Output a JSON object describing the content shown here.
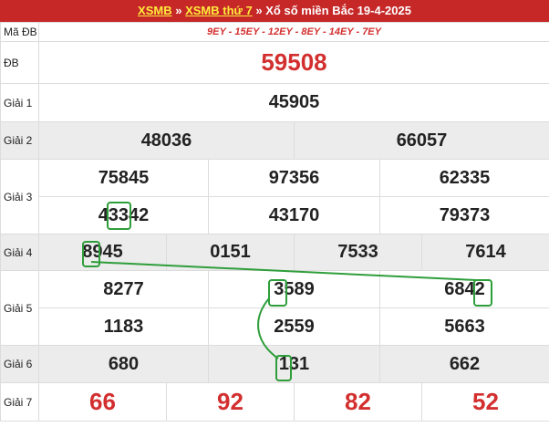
{
  "header": {
    "link1": "XSMB",
    "sep1": " » ",
    "link2": "XSMB thứ 7",
    "sep2": " » ",
    "title": "Xổ số miền Bắc 19-4-2025"
  },
  "ma_db": {
    "label": "Mã ĐB",
    "value": "9EY - 15EY - 12EY - 8EY - 14EY - 7EY"
  },
  "db": {
    "label": "ĐB",
    "value": "59508"
  },
  "g1": {
    "label": "Giải 1",
    "values": [
      "45905"
    ]
  },
  "g2": {
    "label": "Giải 2",
    "values": [
      "48036",
      "66057"
    ]
  },
  "g3": {
    "label": "Giải 3",
    "values": [
      "75845",
      "97356",
      "62335",
      "43342",
      "43170",
      "79373"
    ]
  },
  "g4": {
    "label": "Giải 4",
    "values": [
      "8945",
      "0151",
      "7533",
      "7614"
    ]
  },
  "g5": {
    "label": "Giải 5",
    "values": [
      "8277",
      "3589",
      "6842",
      "1183",
      "2559",
      "5663"
    ]
  },
  "g6": {
    "label": "Giải 6",
    "values": [
      "680",
      "131",
      "662"
    ]
  },
  "g7": {
    "label": "Giải 7",
    "values": [
      "66",
      "92",
      "82",
      "52"
    ]
  },
  "colors": {
    "header_bg": "#c62828",
    "accent_red": "#d32f2f",
    "highlight_green": "#2e9e3a",
    "row_gray": "#ececec"
  }
}
